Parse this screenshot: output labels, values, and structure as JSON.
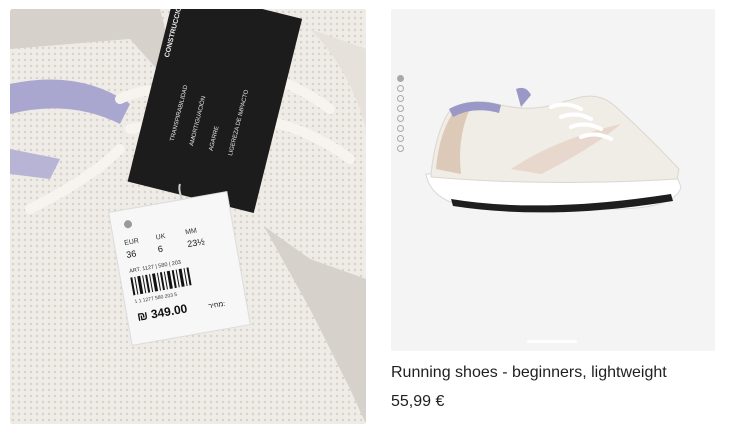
{
  "photo": {
    "tag_label_lines": [
      "CONSTRUCCIÓN FLEXIBLE",
      "TRANSPIRABILIDAD",
      "AMORTIGUACIÓN",
      "AGARRE",
      "LIGEREZA DE IMPACTO"
    ],
    "tag_sizes": {
      "eur": "36",
      "uk": "6",
      "mm": "23½"
    },
    "tag_barcode_number": "1 1 1277 580 203 5",
    "tag_article": "ART. 1127 | 580 | 203",
    "tag_price": "₪ 349.00",
    "tag_price_label": "מחיר:"
  },
  "product": {
    "title": "Running shoes - beginners, lightweight",
    "price": "55,99 €",
    "gallery_dots": 8,
    "active_dot": 0
  },
  "colors": {
    "shoe_upper": "#f1eee9",
    "shoe_accent": "#9898c4",
    "tag_black": "#1c1c1c",
    "panel_bg": "#f4f4f4"
  }
}
